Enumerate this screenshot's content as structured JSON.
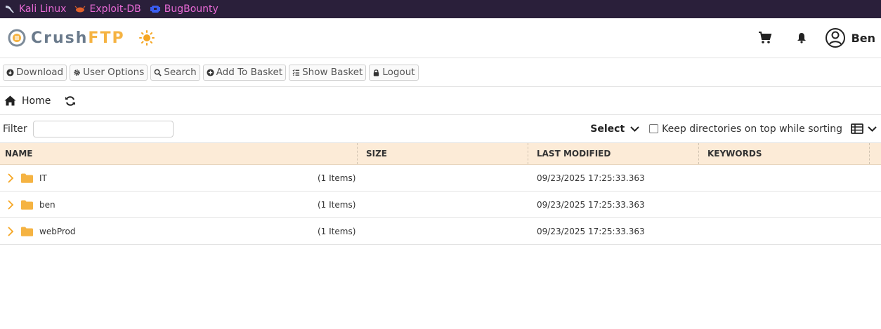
{
  "bookmarks": [
    {
      "label": "Kali Linux",
      "icon": "kali-dragon-icon"
    },
    {
      "label": "Exploit-DB",
      "icon": "exploit-db-bug-icon"
    },
    {
      "label": "BugBounty",
      "icon": "bugbounty-icon"
    }
  ],
  "header": {
    "logo_part1": "Crush",
    "logo_part2": "FTP",
    "user_name": "Ben"
  },
  "toolbar": {
    "download": "Download",
    "user_options": "User Options",
    "search": "Search",
    "add_to_basket": "Add To Basket",
    "show_basket": "Show Basket",
    "logout": "Logout"
  },
  "breadcrumb": {
    "home": "Home"
  },
  "filter": {
    "label": "Filter",
    "value": "",
    "select_label": "Select",
    "keep_dirs_label": "Keep directories on top while sorting"
  },
  "table": {
    "columns": [
      "NAME",
      "SIZE",
      "LAST MODIFIED",
      "KEYWORDS"
    ],
    "rows": [
      {
        "name": "IT",
        "items": "(1 Items)",
        "modified": "09/23/2025 17:25:33.363",
        "keywords": ""
      },
      {
        "name": "ben",
        "items": "(1 Items)",
        "modified": "09/23/2025 17:25:33.363",
        "keywords": ""
      },
      {
        "name": "webProd",
        "items": "(1 Items)",
        "modified": "09/23/2025 17:25:33.363",
        "keywords": ""
      }
    ]
  },
  "colors": {
    "bookmark_bar": "#2a1f3a",
    "bookmark_text": "#e86ad6",
    "accent": "#f5b342",
    "header_row": "#fcebd7"
  }
}
